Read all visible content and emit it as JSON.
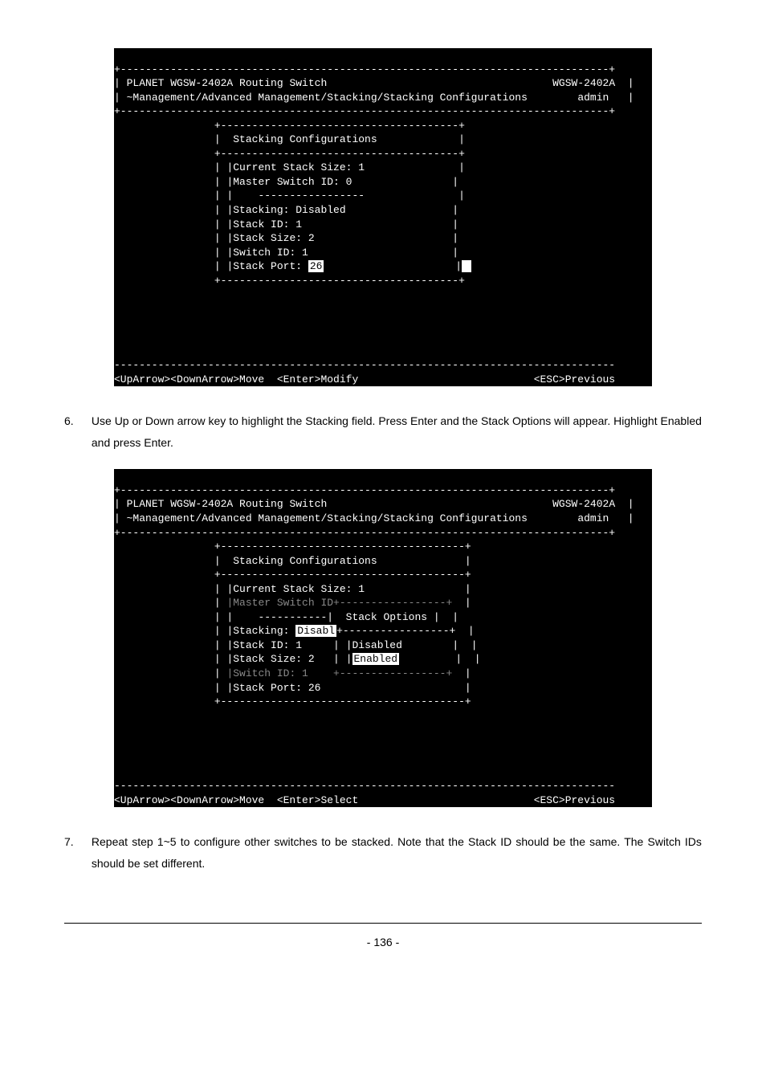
{
  "term1": {
    "title_left": "PLANET WGSW-2402A Routing Switch",
    "title_right": "WGSW-2402A",
    "path": "~Management/Advanced Management/Stacking/Stacking Configurations",
    "user": "admin",
    "box_title": "Stacking Configurations",
    "cur_stack_size": "|Current Stack Size: 1",
    "master_switch": "|Master Switch ID: 0",
    "divider": "-----------------",
    "stacking": "|Stacking: Disabled",
    "stack_id": "|Stack ID: 1",
    "stack_size": "|Stack Size: 2",
    "switch_id": "|Switch ID: 1",
    "stack_port_lbl": "|Stack Port: ",
    "stack_port_val": "26",
    "footer_left": "<UpArrow><DownArrow>Move  <Enter>Modify",
    "footer_right": "<ESC>Previous"
  },
  "step6": {
    "num": "6.",
    "text": "Use Up or Down arrow key to highlight the Stacking field. Press Enter and the Stack Options will appear. Highlight Enabled and press Enter."
  },
  "term2": {
    "title_left": "PLANET WGSW-2402A Routing Switch",
    "title_right": "WGSW-2402A",
    "path": "~Management/Advanced Management/Stacking/Stacking Configurations",
    "user": "admin",
    "box_title": "Stacking Configurations",
    "cur_stack_size": "|Current Stack Size: 1",
    "master_switch_dim": "|Master Switch ID+-----------------+",
    "stack_opt": "-----------|  Stack Options |",
    "stacking_lbl": "|Stacking: ",
    "stacking_val": "Disabl",
    "stacking_after": "+-----------------+",
    "stack_id": "|Stack ID: 1     |",
    "disabled": "|Disabled",
    "stack_size": "|Stack Size: 2   |",
    "enabled_lbl": "|",
    "enabled_val": "Enabled",
    "switch_id_dim": "|Switch ID: 1    +-----------------+",
    "stack_port": "|Stack Port: 26",
    "footer_left": "<UpArrow><DownArrow>Move  <Enter>Select",
    "footer_right": "<ESC>Previous"
  },
  "step7": {
    "num": "7.",
    "text": "Repeat step 1~5 to configure other switches to be stacked. Note that the Stack ID should be the same. The Switch IDs should be set different."
  },
  "page_num": "- 136 -"
}
